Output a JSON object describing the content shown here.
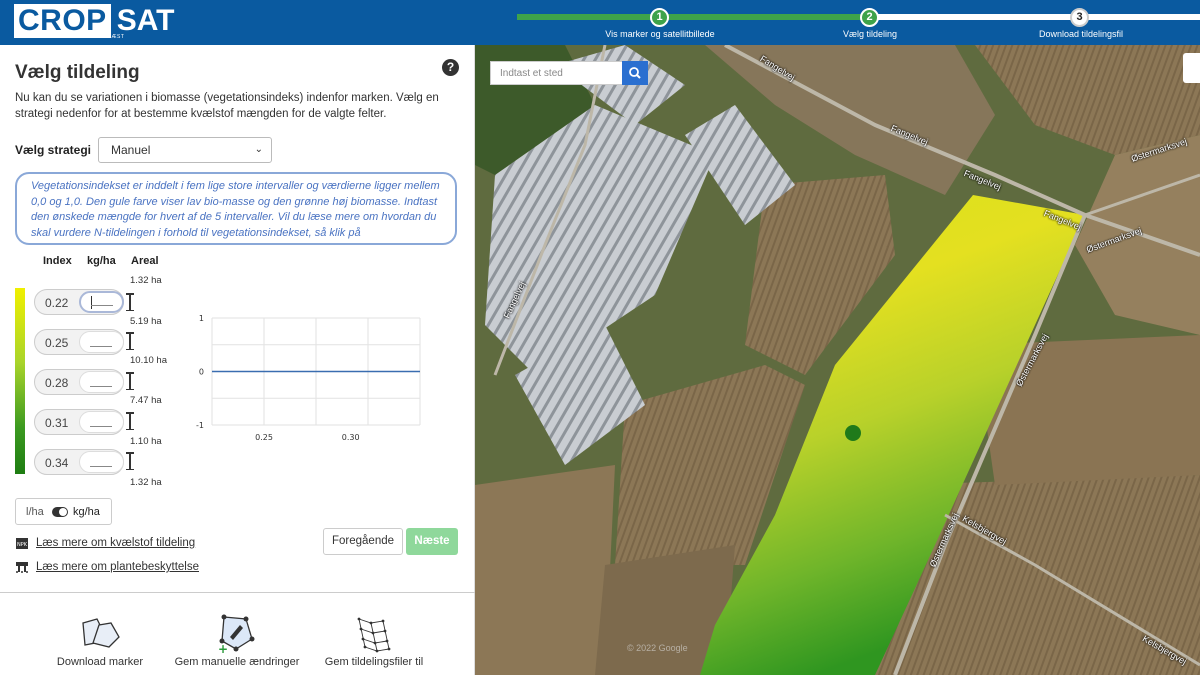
{
  "header": {
    "logo_primary": "CROP",
    "logo_secondary": "SAT",
    "logo_sub": "BY DATAVÆST",
    "steps": [
      {
        "number": "1",
        "label": "Vis marker og satellitbillede"
      },
      {
        "number": "2",
        "label": "Vælg tildeling"
      },
      {
        "number": "3",
        "label": "Download tildelingsfil"
      }
    ]
  },
  "panel": {
    "title": "Vælg tildeling",
    "intro": "Nu kan du se variationen i biomasse (vegetationsindeks) indenfor marken. Vælg en strategi nedenfor for at bestemme kvælstof mængden for de valgte felter.",
    "strategy_label": "Vælg strategi",
    "strategy_value": "Manuel",
    "info_text": "Vegetationsindekset er inddelt i fem lige store intervaller og værdierne ligger mellem 0,0 og 1,0. Den gule farve viser lav bio-masse og den grønne høj biomasse. Indtast den ønskede mængde for hvert af de 5 intervaller. Vil du læse mere om hvordan du skal vurdere N-tildelingen i forhold til vegetationsindekset, så klik på",
    "columns": {
      "index": "Index",
      "kg": "kg/ha",
      "area": "Areal"
    },
    "intervals": [
      {
        "index": "0.22"
      },
      {
        "index": "0.25"
      },
      {
        "index": "0.28"
      },
      {
        "index": "0.31"
      },
      {
        "index": "0.34"
      }
    ],
    "areas": [
      "1.32 ha",
      "5.19 ha",
      "10.10 ha",
      "7.47 ha",
      "1.10 ha",
      "1.32 ha"
    ],
    "unit_left": "l/ha",
    "unit_right": "kg/ha",
    "link_1": "Læs mere om kvælstof tildeling",
    "link_2": "Læs mere om plantebeskyttelse",
    "btn_prev": "Foregående",
    "btn_next": "Næste",
    "bottom": [
      {
        "label": "Download marker"
      },
      {
        "label": "Gem manuelle ændringer"
      },
      {
        "label": "Gem tildelingsfiler til"
      }
    ]
  },
  "chart_data": {
    "type": "line",
    "x": [
      0.22,
      0.34
    ],
    "series": [
      {
        "values": [
          0,
          0
        ]
      }
    ],
    "xticks": [
      "0.25",
      "0.30"
    ],
    "yticks": [
      "1",
      "0",
      "-1"
    ],
    "xlim": [
      0.22,
      0.34
    ],
    "ylim": [
      -1,
      1
    ],
    "grid": true,
    "color": "#3a6db0"
  },
  "map": {
    "search_placeholder": "Indtast et sted",
    "roads": [
      "Fangelvej",
      "Fangelvej",
      "Fangelvej",
      "Fangelvej",
      "Østermarksvej",
      "Østermarksvej",
      "Østermarksvej",
      "Østermarksvej",
      "Kelsbjergvej",
      "Kelsbjergvej",
      "Fangelvej"
    ],
    "watermark": "© 2022 Google"
  },
  "colors": {
    "brand": "#0a5aa0",
    "progress": "#3ea34a",
    "next_button": "#8fd89b",
    "info_border": "#8aa8d8"
  }
}
